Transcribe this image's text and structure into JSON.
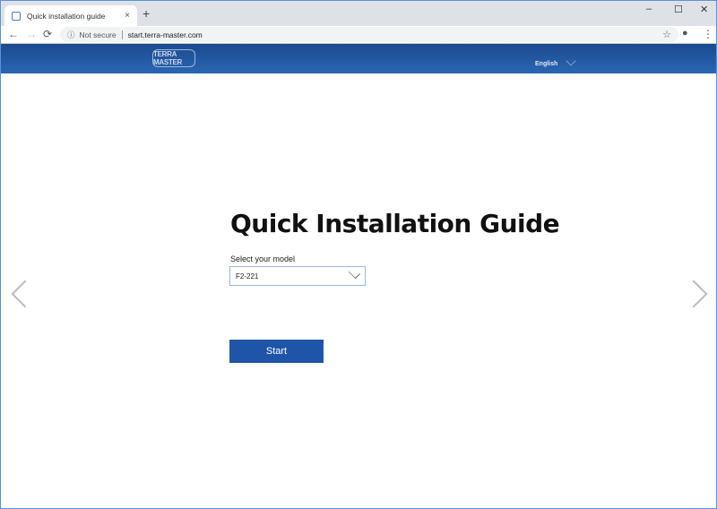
{
  "browser": {
    "tab_title": "Quick installation guide",
    "new_tab": "+",
    "close": "×",
    "minimize": "–",
    "maximize": "☐",
    "close_window": "✕",
    "back": "←",
    "forward": "→",
    "reload": "⟳",
    "info": "ⓘ",
    "security": "Not secure",
    "url": "start.terra-master.com",
    "star": "☆",
    "profile": "●",
    "menu": "⋮"
  },
  "header": {
    "logo": "TERRA MASTER",
    "language": "English"
  },
  "main": {
    "title": "Quick Installation Guide",
    "model_label": "Select your model",
    "model_value": "F2-221",
    "start": "Start"
  }
}
